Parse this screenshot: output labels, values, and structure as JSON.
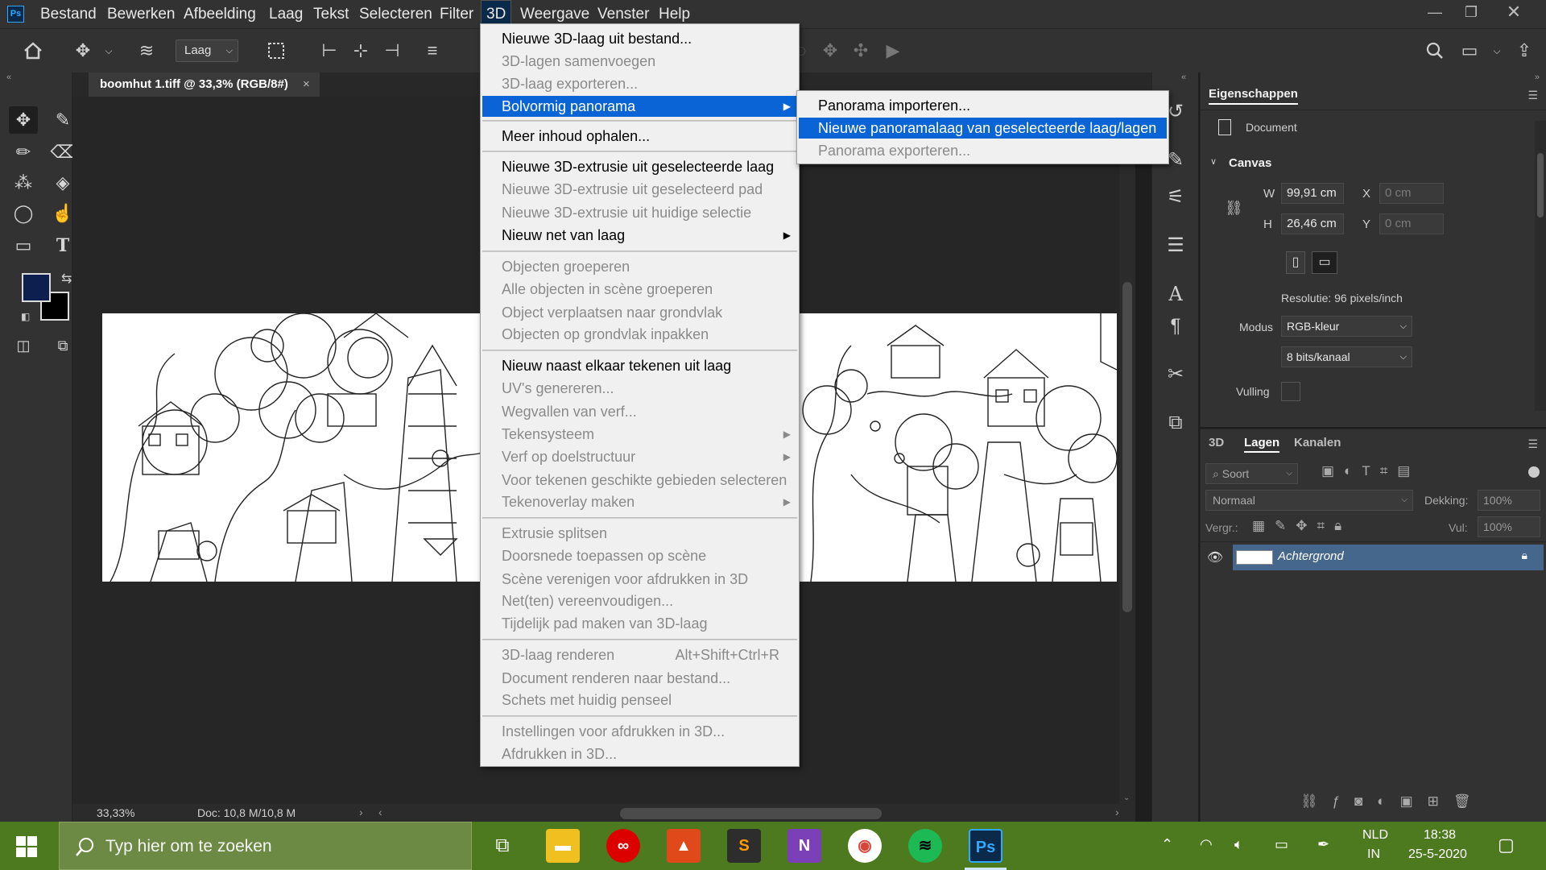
{
  "app": {
    "logo": "Ps",
    "menus": [
      "Bestand",
      "Bewerken",
      "Afbeelding",
      "Laag",
      "Tekst",
      "Selecteren",
      "Filter",
      "3D",
      "Weergave",
      "Venster",
      "Help"
    ],
    "active_menu": "3D"
  },
  "options_bar": {
    "layer_select": "Laag"
  },
  "document": {
    "tab_title": "boomhut 1.tiff @ 33,3% (RGB/8#)",
    "zoom": "33,33%",
    "doc_info": "Doc: 10,8 M/10,8 M"
  },
  "colors": {
    "foreground": "#0d1f4f",
    "background": "#000000",
    "accent": "#0a64d6",
    "taskbar": "#4e7a1f"
  },
  "menu_3d": {
    "items": [
      {
        "label": "Nieuwe 3D-laag uit bestand...",
        "enabled": true
      },
      {
        "label": "3D-lagen samenvoegen",
        "enabled": false
      },
      {
        "label": "3D-laag exporteren...",
        "enabled": false
      },
      {
        "label": "Bolvormig panorama",
        "enabled": true,
        "highlighted": true,
        "submenu": true
      },
      {
        "label": "Meer inhoud ophalen...",
        "enabled": true
      },
      {
        "label": "Nieuwe 3D-extrusie uit geselecteerde laag",
        "enabled": true
      },
      {
        "label": "Nieuwe 3D-extrusie uit geselecteerd pad",
        "enabled": false
      },
      {
        "label": "Nieuwe 3D-extrusie uit huidige selectie",
        "enabled": false
      },
      {
        "label": "Nieuw net van laag",
        "enabled": true,
        "submenu": true
      },
      {
        "label": "Objecten groeperen",
        "enabled": false
      },
      {
        "label": "Alle objecten in scène groeperen",
        "enabled": false
      },
      {
        "label": "Object verplaatsen naar grondvlak",
        "enabled": false
      },
      {
        "label": "Objecten op grondvlak inpakken",
        "enabled": false
      },
      {
        "label": "Nieuw naast elkaar tekenen uit laag",
        "enabled": true
      },
      {
        "label": "UV's genereren...",
        "enabled": false
      },
      {
        "label": "Wegvallen van verf...",
        "enabled": false
      },
      {
        "label": "Tekensysteem",
        "enabled": false,
        "submenu": true
      },
      {
        "label": "Verf op doelstructuur",
        "enabled": false,
        "submenu": true
      },
      {
        "label": "Voor tekenen geschikte gebieden selecteren",
        "enabled": false
      },
      {
        "label": "Tekenoverlay maken",
        "enabled": false,
        "submenu": true
      },
      {
        "label": "Extrusie splitsen",
        "enabled": false
      },
      {
        "label": "Doorsnede toepassen op scène",
        "enabled": false
      },
      {
        "label": "Scène verenigen voor afdrukken in 3D",
        "enabled": false
      },
      {
        "label": "Net(ten) vereenvoudigen...",
        "enabled": false
      },
      {
        "label": "Tijdelijk pad maken van 3D-laag",
        "enabled": false
      },
      {
        "label": "3D-laag renderen",
        "enabled": false,
        "shortcut": "Alt+Shift+Ctrl+R"
      },
      {
        "label": "Document renderen naar bestand...",
        "enabled": false
      },
      {
        "label": "Schets met huidig penseel",
        "enabled": false
      },
      {
        "label": "Instellingen voor afdrukken in 3D...",
        "enabled": false
      },
      {
        "label": "Afdrukken in 3D...",
        "enabled": false
      }
    ]
  },
  "submenu_panorama": {
    "items": [
      {
        "label": "Panorama importeren...",
        "enabled": true
      },
      {
        "label": "Nieuwe panoramalaag van geselecteerde laag/lagen",
        "enabled": true,
        "highlighted": true
      },
      {
        "label": "Panorama exporteren...",
        "enabled": false
      }
    ]
  },
  "properties": {
    "title": "Eigenschappen",
    "doc_label": "Document",
    "canvas_section": "Canvas",
    "w_label": "W",
    "w_value": "99,91 cm",
    "h_label": "H",
    "h_value": "26,46 cm",
    "x_label": "X",
    "x_value": "0 cm",
    "y_label": "Y",
    "y_value": "0 cm",
    "resolution": "Resolutie: 96 pixels/inch",
    "mode_label": "Modus",
    "mode_value": "RGB-kleur",
    "depth_value": "8 bits/kanaal",
    "fill_label": "Vulling"
  },
  "layers_panel": {
    "tabs": [
      "3D",
      "Lagen",
      "Kanalen"
    ],
    "active_tab": "Lagen",
    "filter_placeholder": "Soort",
    "blend_mode": "Normaal",
    "opacity_label": "Dekking:",
    "opacity_value": "100%",
    "lock_label": "Vergr.:",
    "fill_label": "Vul:",
    "fill_value": "100%",
    "layers": [
      {
        "name": "Achtergrond",
        "visible": true,
        "locked": true
      }
    ]
  },
  "taskbar": {
    "search_placeholder": "Typ hier om te zoeken",
    "language_line1": "NLD",
    "language_line2": "IN",
    "time": "18:38",
    "date": "25-5-2020"
  }
}
